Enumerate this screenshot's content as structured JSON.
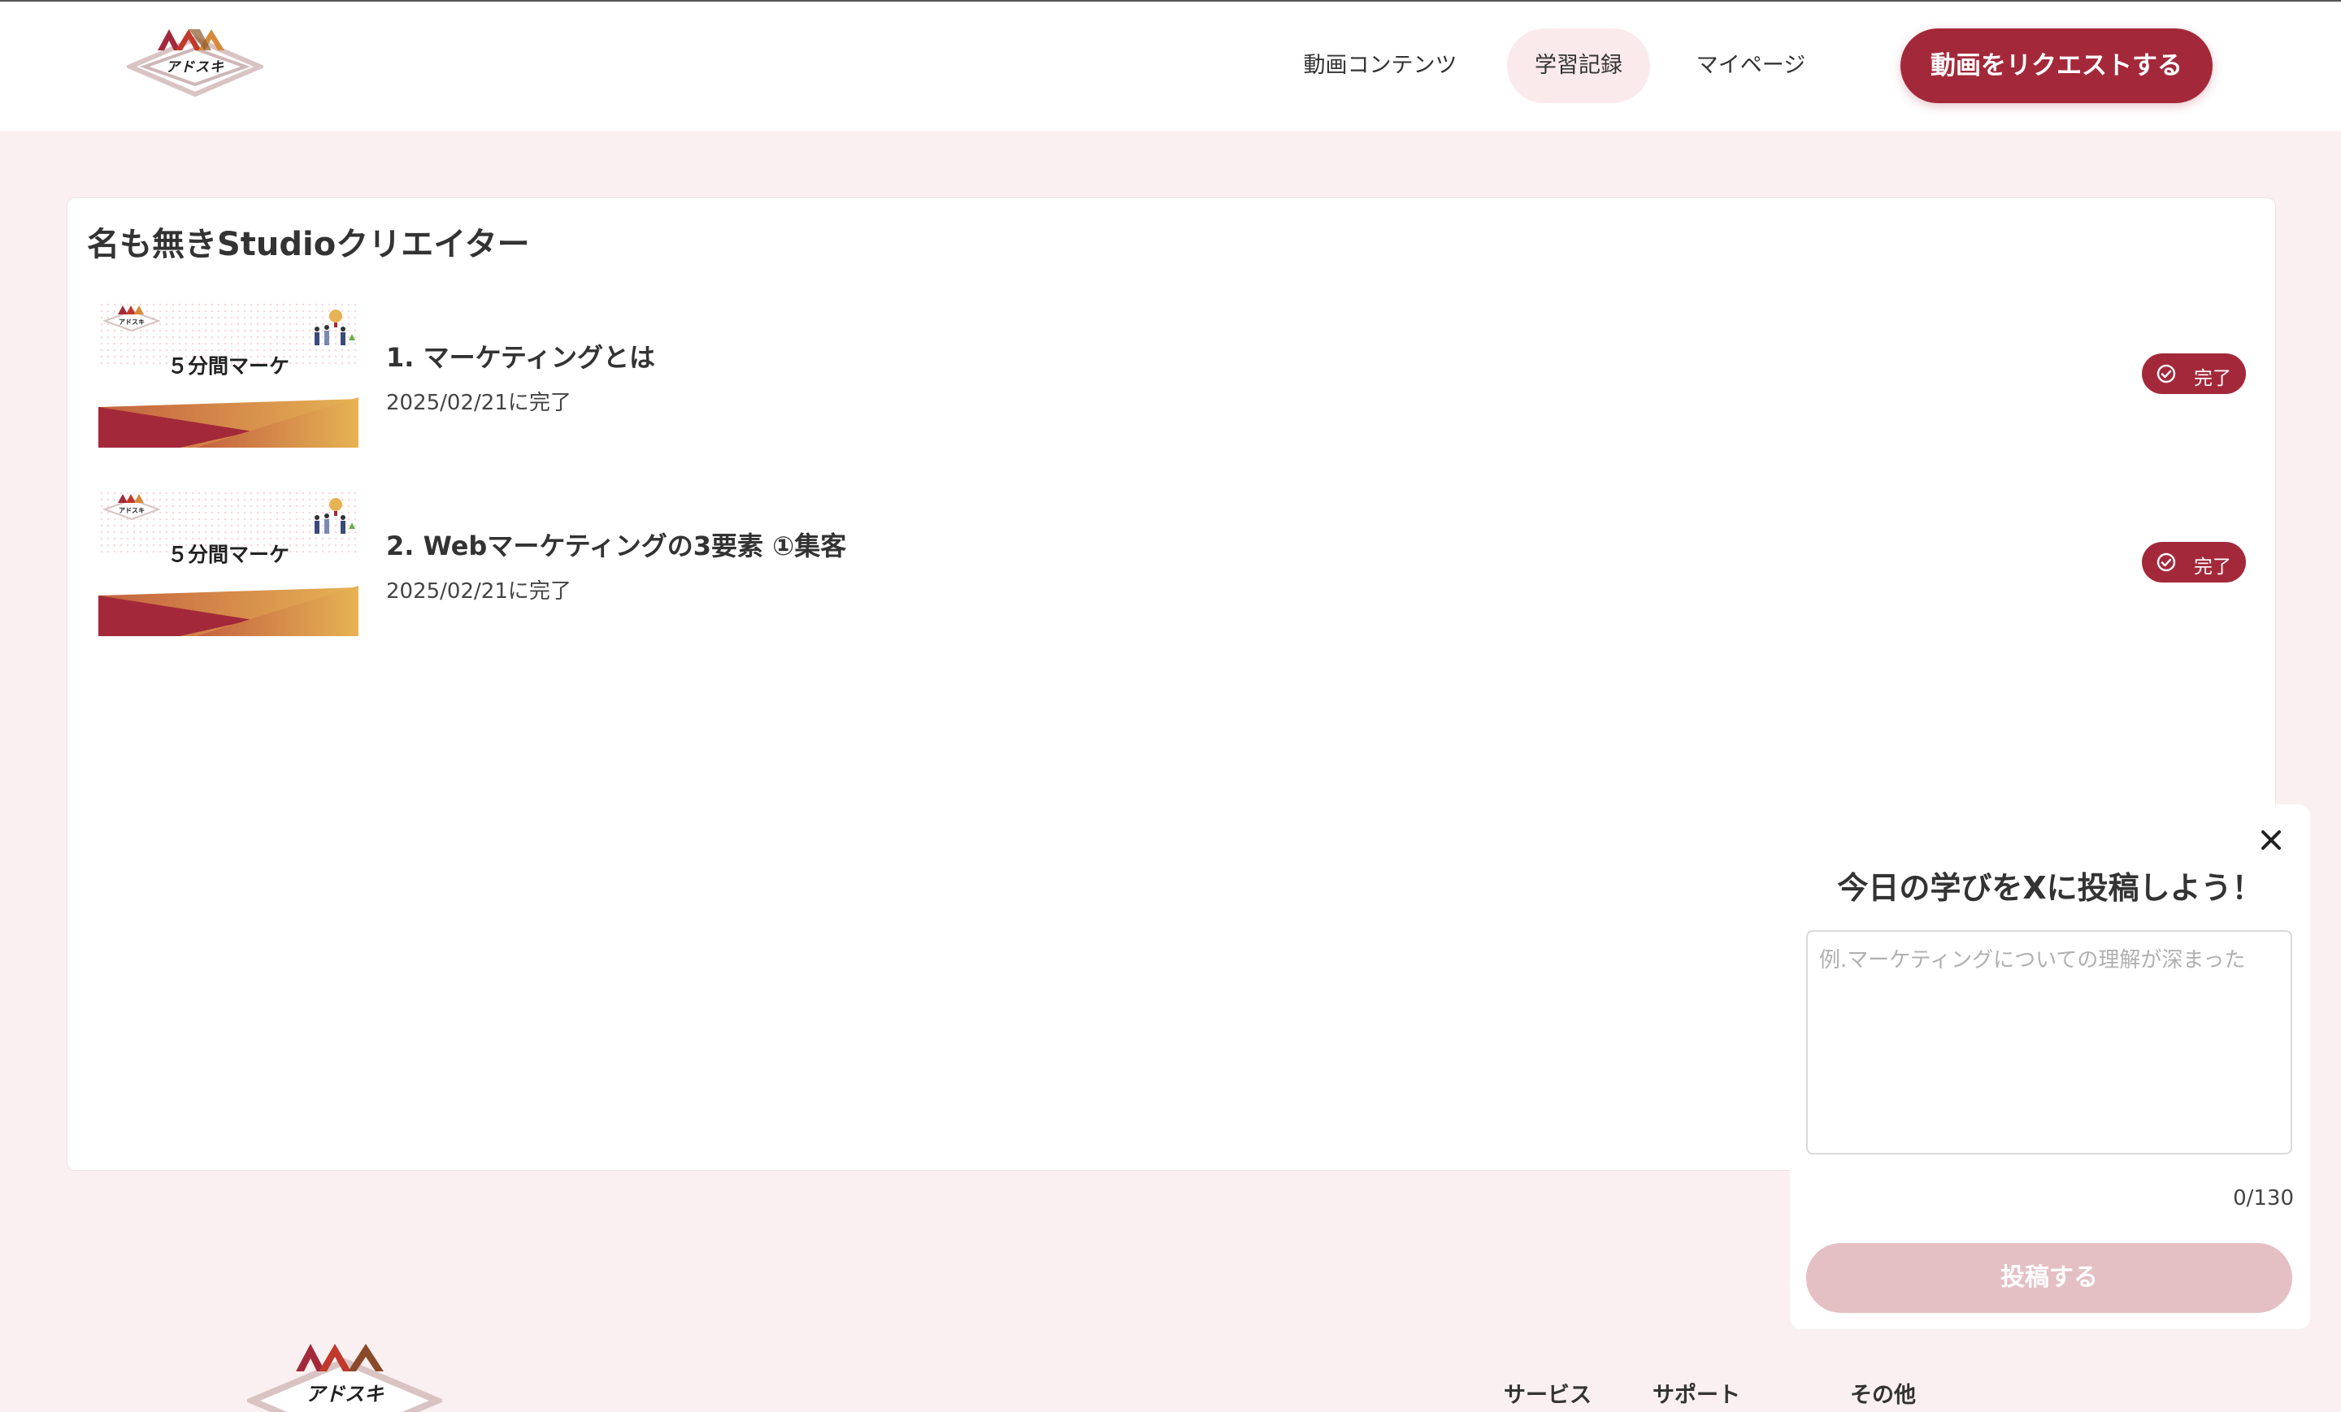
{
  "header": {
    "logo_text": "アドスキ",
    "nav": [
      {
        "label": "動画コンテンツ",
        "active": false
      },
      {
        "label": "学習記録",
        "active": true
      },
      {
        "label": "マイページ",
        "active": false
      }
    ],
    "request_button": "動画をリクエストする"
  },
  "main": {
    "title": "名も無きStudioクリエイター",
    "items": [
      {
        "thumb_text": "５分間マーケ",
        "title": "1. マーケティングとは",
        "date": "2025/02/21に完了",
        "badge": "完了"
      },
      {
        "thumb_text": "５分間マーケ",
        "title": "2. Webマーケティングの3要素 ①集客",
        "date": "2025/02/21に完了",
        "badge": "完了"
      }
    ]
  },
  "popup": {
    "title": "今日の学びをXに投稿しよう！",
    "placeholder": "例.マーケティングについての理解が深まった",
    "value": "",
    "counter": "0/130",
    "submit": "投稿する"
  },
  "footer": {
    "logo_text": "アドスキ",
    "links": [
      "サービス",
      "サポート",
      "その他"
    ]
  },
  "colors": {
    "brand": "#a3293a",
    "page_bg": "#fbf0f1",
    "nav_active_bg": "#fbeaec",
    "submit_disabled": "#e4bfc3"
  }
}
